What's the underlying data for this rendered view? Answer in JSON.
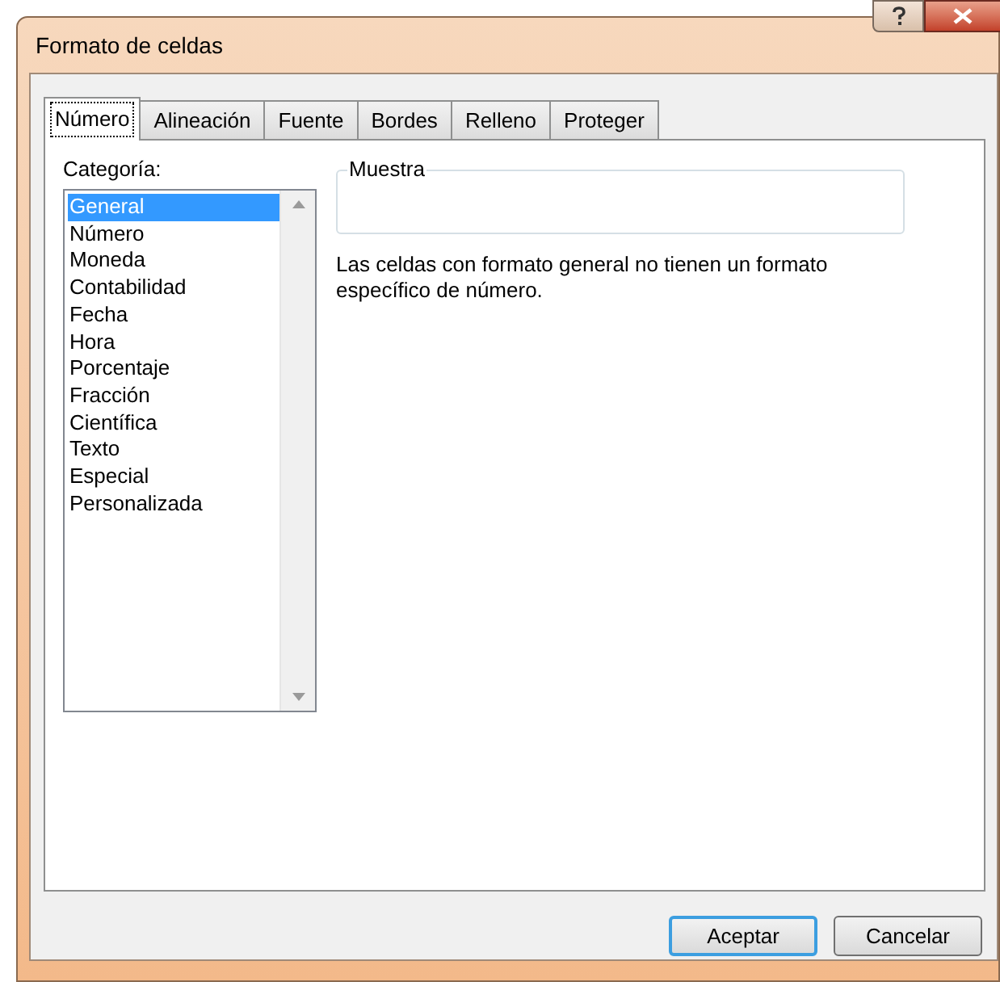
{
  "window": {
    "title": "Formato de celdas"
  },
  "tabs": [
    {
      "label": "Número",
      "selected": true
    },
    {
      "label": "Alineación",
      "selected": false
    },
    {
      "label": "Fuente",
      "selected": false
    },
    {
      "label": "Bordes",
      "selected": false
    },
    {
      "label": "Relleno",
      "selected": false
    },
    {
      "label": "Proteger",
      "selected": false
    }
  ],
  "category": {
    "label": "Categoría:",
    "items": [
      {
        "label": "General",
        "selected": true
      },
      {
        "label": "Número",
        "selected": false
      },
      {
        "label": "Moneda",
        "selected": false
      },
      {
        "label": "Contabilidad",
        "selected": false
      },
      {
        "label": "Fecha",
        "selected": false
      },
      {
        "label": "Hora",
        "selected": false
      },
      {
        "label": "Porcentaje",
        "selected": false
      },
      {
        "label": "Fracción",
        "selected": false
      },
      {
        "label": "Científica",
        "selected": false
      },
      {
        "label": "Texto",
        "selected": false
      },
      {
        "label": "Especial",
        "selected": false
      },
      {
        "label": "Personalizada",
        "selected": false
      }
    ]
  },
  "sample": {
    "label": "Muestra"
  },
  "description": "Las celdas con formato general no tienen un formato específico de número.",
  "buttons": [
    {
      "label": "Aceptar",
      "kind": "default"
    },
    {
      "label": "Cancelar",
      "kind": "normal"
    }
  ]
}
